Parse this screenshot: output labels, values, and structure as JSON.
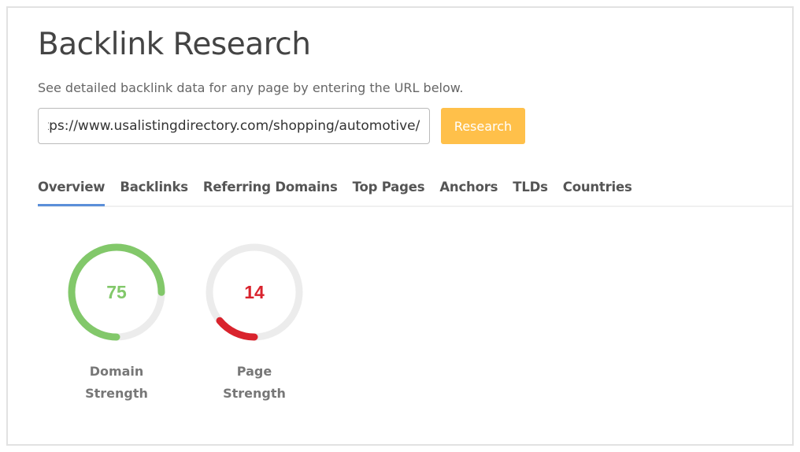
{
  "header": {
    "title": "Backlink Research",
    "subtitle": "See detailed backlink data for any page by entering the URL below."
  },
  "search": {
    "value": "https://www.usalistingdirectory.com/shopping/automotive/",
    "button_label": "Research"
  },
  "tabs": [
    {
      "label": "Overview",
      "active": true
    },
    {
      "label": "Backlinks"
    },
    {
      "label": "Referring Domains"
    },
    {
      "label": "Top Pages"
    },
    {
      "label": "Anchors"
    },
    {
      "label": "TLDs"
    },
    {
      "label": "Countries"
    }
  ],
  "gauges": [
    {
      "value": 75,
      "max": 100,
      "label": "Domain Strength",
      "color": "#82c86a"
    },
    {
      "value": 14,
      "max": 100,
      "label": "Page Strength",
      "color": "#d9232d"
    }
  ],
  "colors": {
    "track": "#ececec",
    "accent": "#ffc04a",
    "tab_underline": "#5b8fd9"
  }
}
